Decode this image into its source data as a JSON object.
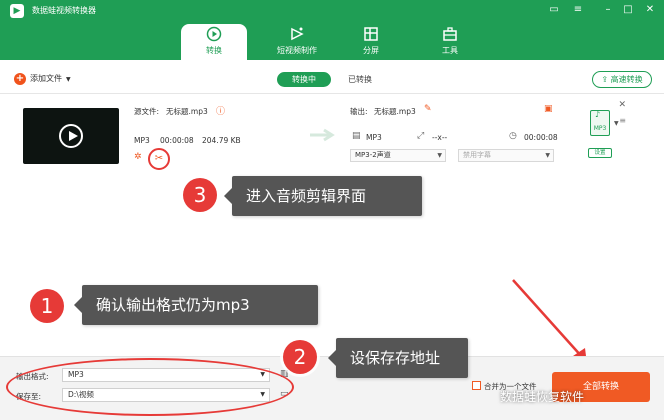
{
  "app": {
    "title": "数据蛙视频转换器"
  },
  "nav": {
    "tabs": [
      {
        "label": "转换",
        "active": true
      },
      {
        "label": "短视频制作",
        "active": false
      },
      {
        "label": "分屏",
        "active": false
      },
      {
        "label": "工具",
        "active": false
      }
    ]
  },
  "toolbar": {
    "add_file": "添加文件",
    "tab_converting": "转换中",
    "tab_converted": "已转换",
    "fast_convert": "高速转换"
  },
  "file": {
    "source_label": "源文件:",
    "source_name": "无标题.mp3",
    "format": "MP3",
    "duration": "00:00:08",
    "size": "204.79 KB",
    "output_label": "输出:",
    "output_name": "无标题.mp3",
    "out_format": "MP3",
    "out_resolution": "--x--",
    "out_duration": "00:00:08",
    "audio_channel": "MP3-2声道",
    "subtitle": "禁用字幕",
    "format_badge": "MP3",
    "settings": "设置"
  },
  "annotations": [
    {
      "num": "3",
      "text": "进入音频剪辑界面"
    },
    {
      "num": "1",
      "text": "确认输出格式仍为mp3"
    },
    {
      "num": "2",
      "text": "设保存存地址"
    }
  ],
  "bottom": {
    "output_format_label": "输出格式:",
    "output_format": "MP3",
    "save_to_label": "保存至:",
    "save_path": "D:\\视频",
    "merge": "合并为一个文件",
    "convert_all": "全部转换"
  },
  "watermark": "数据蛙恢复软件",
  "colors": {
    "brand": "#1f9e55",
    "accent": "#f05a24",
    "annotation": "#e63a37",
    "callout": "#555555"
  }
}
